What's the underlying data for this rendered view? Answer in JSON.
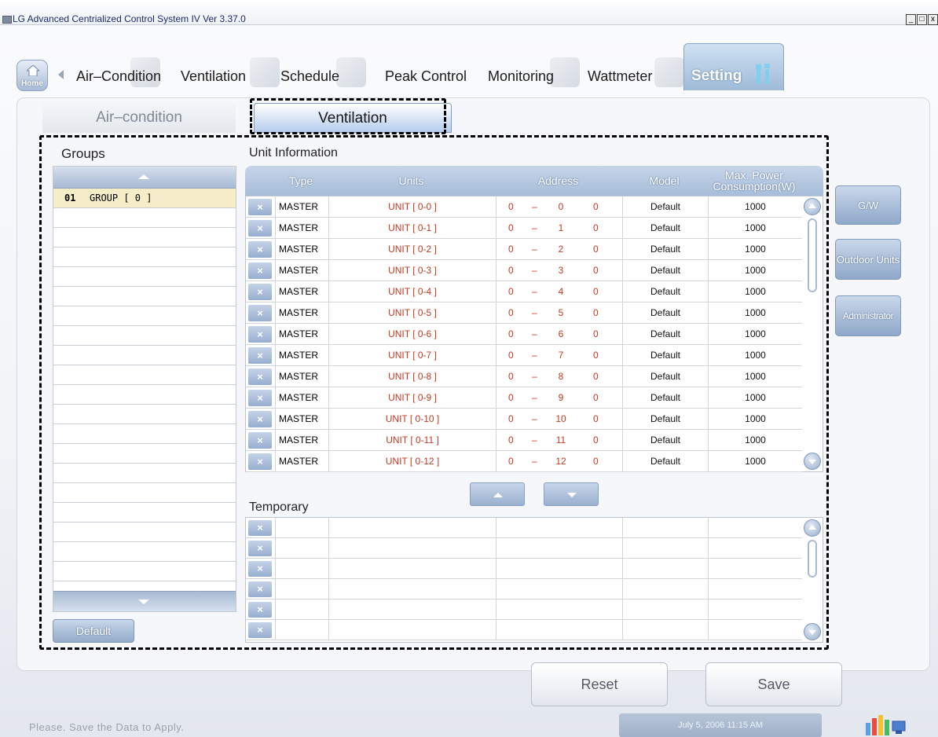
{
  "window": {
    "title": "LG Advanced Centrialized Control System IV Ver 3.37.0",
    "minimize": "_",
    "maximize": "□",
    "close": "x"
  },
  "nav": {
    "home_label": "Home",
    "items": [
      "Air–Condition",
      "Ventilation",
      "Schedule",
      "Peak Control",
      "Monitoring",
      "Wattmeter",
      "Setting"
    ],
    "active": "Setting"
  },
  "subtabs": {
    "air": "Air–condition",
    "vent": "Ventilation",
    "active": "Ventilation"
  },
  "groups": {
    "title": "Groups",
    "items": [
      {
        "num": "01",
        "name": "GROUP [ 0 ]"
      }
    ],
    "default_button": "Default"
  },
  "unit_info": {
    "title": "Unit Information",
    "columns": {
      "type": "Type",
      "units": "Units",
      "address": "Address",
      "model": "Model",
      "power_line1": "Max. Power",
      "power_line2": "Consumption(W)"
    },
    "rows": [
      {
        "type": "MASTER",
        "unit": "UNIT [ 0-0 ]",
        "a1": "0",
        "dash": "–",
        "a2": "0",
        "a3": "0",
        "model": "Default",
        "power": "1000"
      },
      {
        "type": "MASTER",
        "unit": "UNIT [ 0-1 ]",
        "a1": "0",
        "dash": "–",
        "a2": "1",
        "a3": "0",
        "model": "Default",
        "power": "1000"
      },
      {
        "type": "MASTER",
        "unit": "UNIT [ 0-2 ]",
        "a1": "0",
        "dash": "–",
        "a2": "2",
        "a3": "0",
        "model": "Default",
        "power": "1000"
      },
      {
        "type": "MASTER",
        "unit": "UNIT [ 0-3 ]",
        "a1": "0",
        "dash": "–",
        "a2": "3",
        "a3": "0",
        "model": "Default",
        "power": "1000"
      },
      {
        "type": "MASTER",
        "unit": "UNIT [ 0-4 ]",
        "a1": "0",
        "dash": "–",
        "a2": "4",
        "a3": "0",
        "model": "Default",
        "power": "1000"
      },
      {
        "type": "MASTER",
        "unit": "UNIT [ 0-5 ]",
        "a1": "0",
        "dash": "–",
        "a2": "5",
        "a3": "0",
        "model": "Default",
        "power": "1000"
      },
      {
        "type": "MASTER",
        "unit": "UNIT [ 0-6 ]",
        "a1": "0",
        "dash": "–",
        "a2": "6",
        "a3": "0",
        "model": "Default",
        "power": "1000"
      },
      {
        "type": "MASTER",
        "unit": "UNIT [ 0-7 ]",
        "a1": "0",
        "dash": "–",
        "a2": "7",
        "a3": "0",
        "model": "Default",
        "power": "1000"
      },
      {
        "type": "MASTER",
        "unit": "UNIT [ 0-8 ]",
        "a1": "0",
        "dash": "–",
        "a2": "8",
        "a3": "0",
        "model": "Default",
        "power": "1000"
      },
      {
        "type": "MASTER",
        "unit": "UNIT [ 0-9 ]",
        "a1": "0",
        "dash": "–",
        "a2": "9",
        "a3": "0",
        "model": "Default",
        "power": "1000"
      },
      {
        "type": "MASTER",
        "unit": "UNIT [ 0-10 ]",
        "a1": "0",
        "dash": "–",
        "a2": "10",
        "a3": "0",
        "model": "Default",
        "power": "1000"
      },
      {
        "type": "MASTER",
        "unit": "UNIT [ 0-11 ]",
        "a1": "0",
        "dash": "–",
        "a2": "11",
        "a3": "0",
        "model": "Default",
        "power": "1000"
      },
      {
        "type": "MASTER",
        "unit": "UNIT [ 0-12 ]",
        "a1": "0",
        "dash": "–",
        "a2": "12",
        "a3": "0",
        "model": "Default",
        "power": "1000"
      }
    ],
    "delete_glyph": "×"
  },
  "temporary": {
    "title": "Temporary",
    "row_count": 6
  },
  "side_buttons": {
    "gw": "G/W",
    "outdoor": "Outdoor Units",
    "admin": "Administrator"
  },
  "actions": {
    "reset": "Reset",
    "save": "Save"
  },
  "status": {
    "message": "Please. Save the Data to Apply.",
    "datetime": "July 5, 2006 11:15 AM"
  },
  "icons": {
    "home": "house-icon",
    "setting": "tools-icon",
    "tray": "system-status-icon"
  }
}
